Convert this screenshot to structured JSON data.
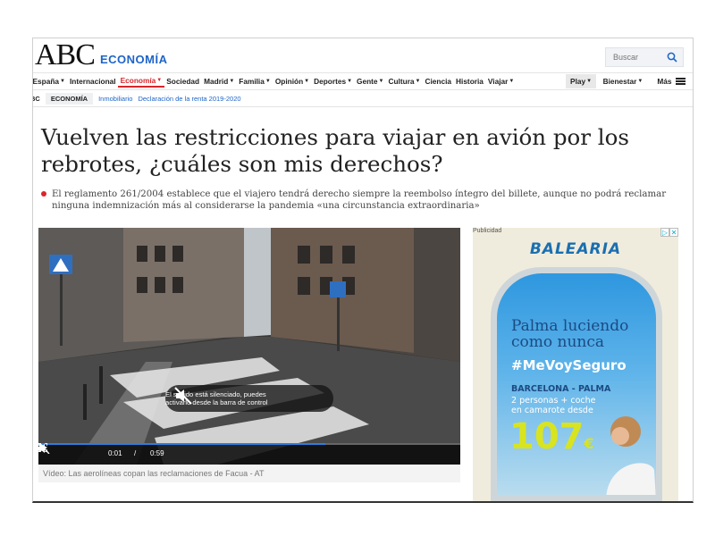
{
  "header": {
    "logo": "ABC",
    "section": "ECONOMÍA",
    "search_placeholder": "Buscar"
  },
  "nav": {
    "items": [
      {
        "label": "España",
        "caret": true
      },
      {
        "label": "Internacional",
        "caret": false
      },
      {
        "label": "Economía",
        "caret": true,
        "active": true
      },
      {
        "label": "Sociedad",
        "caret": false
      },
      {
        "label": "Madrid",
        "caret": true
      },
      {
        "label": "Familia",
        "caret": true
      },
      {
        "label": "Opinión",
        "caret": true
      },
      {
        "label": "Deportes",
        "caret": true
      },
      {
        "label": "Gente",
        "caret": true
      },
      {
        "label": "Cultura",
        "caret": true
      },
      {
        "label": "Ciencia",
        "caret": false
      },
      {
        "label": "Historia",
        "caret": false
      },
      {
        "label": "Viajar",
        "caret": true
      }
    ],
    "play": "Play",
    "bienestar": "Bienestar",
    "more": "Más"
  },
  "breadcrumb": {
    "root": "BC",
    "section": "ECONOMÍA",
    "links": [
      "Inmobiliario",
      "Declaración de la renta 2019-2020"
    ]
  },
  "article": {
    "headline": "Vuelven las restricciones para viajar en avión por los rebrotes, ¿cuáles son mis derechos?",
    "summary": "El reglamento 261/2004 establece que el viajero tendrá derecho siempre la reembolso íntegro del billete, aunque no podrá reclamar ninguna indemnización más al considerarse la pandemia «una circunstancia extraordinaria»"
  },
  "video": {
    "mute_notice_line1": "El sonido está silenciado, puedes",
    "mute_notice_line2": "activarlo desde la barra de control",
    "current_time": "0:01",
    "separator": "/",
    "duration": "0:59",
    "progress": 0.68,
    "caption": "Vídeo: Las aerolíneas copan las reclamaciones de Facua - AT"
  },
  "ad": {
    "label": "Publicidad",
    "brand": "BALEARIA",
    "headline_line1": "Palma luciendo",
    "headline_line2": "como nunca",
    "hashtag": "#MeVoySeguro",
    "route": "BARCELONA - PALMA",
    "offer_line1": "2 personas + coche",
    "offer_line2": "en camarote desde",
    "price": "107",
    "currency": "€",
    "colors": {
      "brand": "#1a6fb0",
      "price": "#d8e41f"
    }
  },
  "colors": {
    "accent": "#d9262c",
    "link": "#1e64c8"
  }
}
